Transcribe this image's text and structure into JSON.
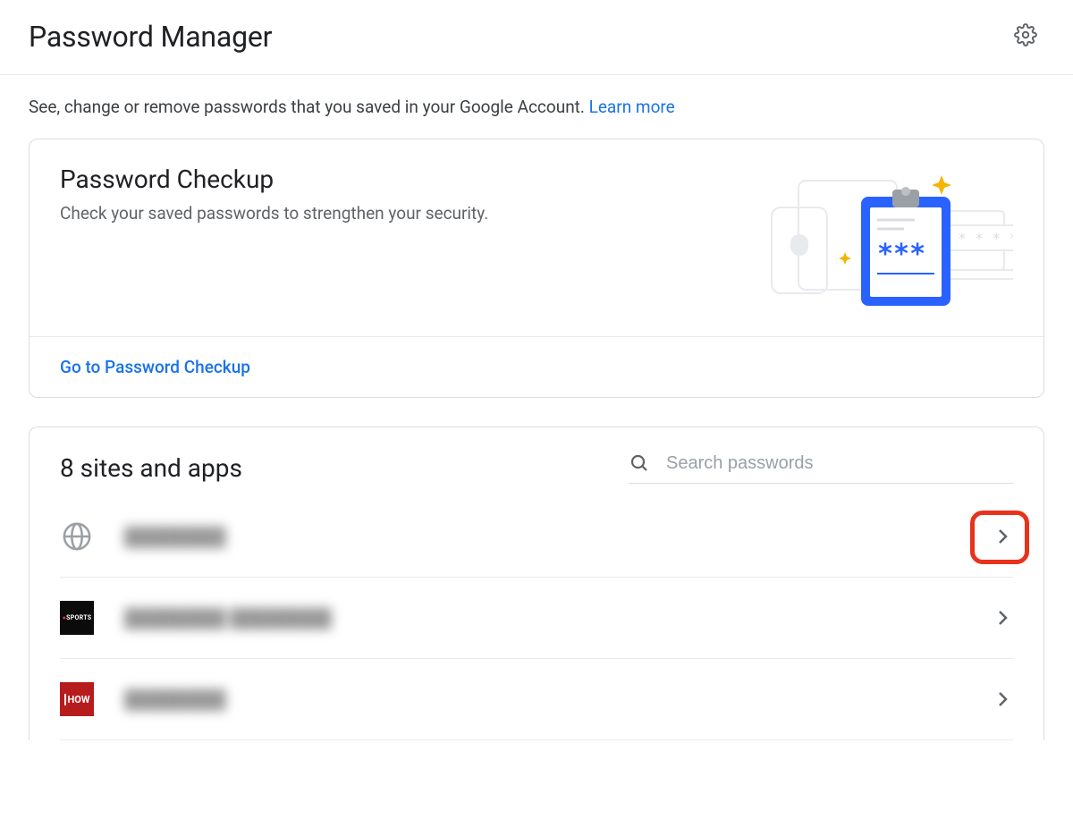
{
  "header": {
    "title": "Password Manager"
  },
  "intro": {
    "text": "See, change or remove passwords that you saved in your Google Account. ",
    "link_label": "Learn more"
  },
  "checkup": {
    "title": "Password Checkup",
    "subtitle": "Check your saved passwords to strengthen your security.",
    "cta": "Go to Password Checkup"
  },
  "list": {
    "heading": "8 sites and apps",
    "search_placeholder": "Search passwords",
    "items": [
      {
        "name": "████████"
      },
      {
        "name": "████████ ████████"
      },
      {
        "name": "████████"
      }
    ]
  }
}
